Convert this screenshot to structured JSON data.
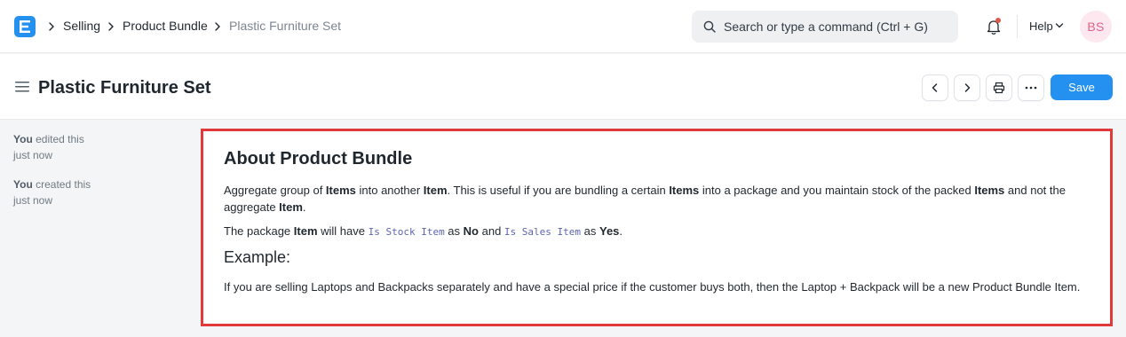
{
  "navbar": {
    "logo_letter": "E",
    "breadcrumbs": [
      "Selling",
      "Product Bundle",
      "Plastic Furniture Set"
    ],
    "search_placeholder": "Search or type a command (Ctrl + G)",
    "help_label": "Help",
    "avatar_initials": "BS"
  },
  "page": {
    "title": "Plastic Furniture Set",
    "save_label": "Save"
  },
  "timeline": [
    {
      "actor": "You",
      "action": "edited this",
      "time": "just now"
    },
    {
      "actor": "You",
      "action": "created this",
      "time": "just now"
    }
  ],
  "about": {
    "heading": "About Product Bundle",
    "p1": {
      "t1": "Aggregate group of ",
      "b1": "Items",
      "t2": " into another ",
      "b2": "Item",
      "t3": ". This is useful if you are bundling a certain ",
      "b3": "Items",
      "t4": " into a package and you maintain stock of the packed ",
      "b4": "Items",
      "t5": " and not the aggregate ",
      "b5": "Item",
      "t6": "."
    },
    "p2": {
      "t1": "The package ",
      "b1": "Item",
      "t2": " will have ",
      "c1": "Is Stock Item",
      "t3": " as ",
      "b2": "No",
      "t4": " and ",
      "c2": "Is Sales Item",
      "t5": " as ",
      "b3": "Yes",
      "t6": "."
    },
    "example_heading": "Example:",
    "example_text": "If you are selling Laptops and Backpacks separately and have a special price if the customer buys both, then the Laptop + Backpack will be a new Product Bundle Item."
  },
  "colors": {
    "accent": "#2490ef",
    "highlight_border": "#e23a3a",
    "avatar_bg": "#fde8ef",
    "avatar_text": "#e4638a"
  },
  "icons": [
    "app-logo-icon",
    "chevron-right-icon",
    "search-icon",
    "bell-icon",
    "chevron-down-icon",
    "hamburger-icon",
    "chevron-left-icon",
    "printer-icon",
    "more-icon"
  ]
}
